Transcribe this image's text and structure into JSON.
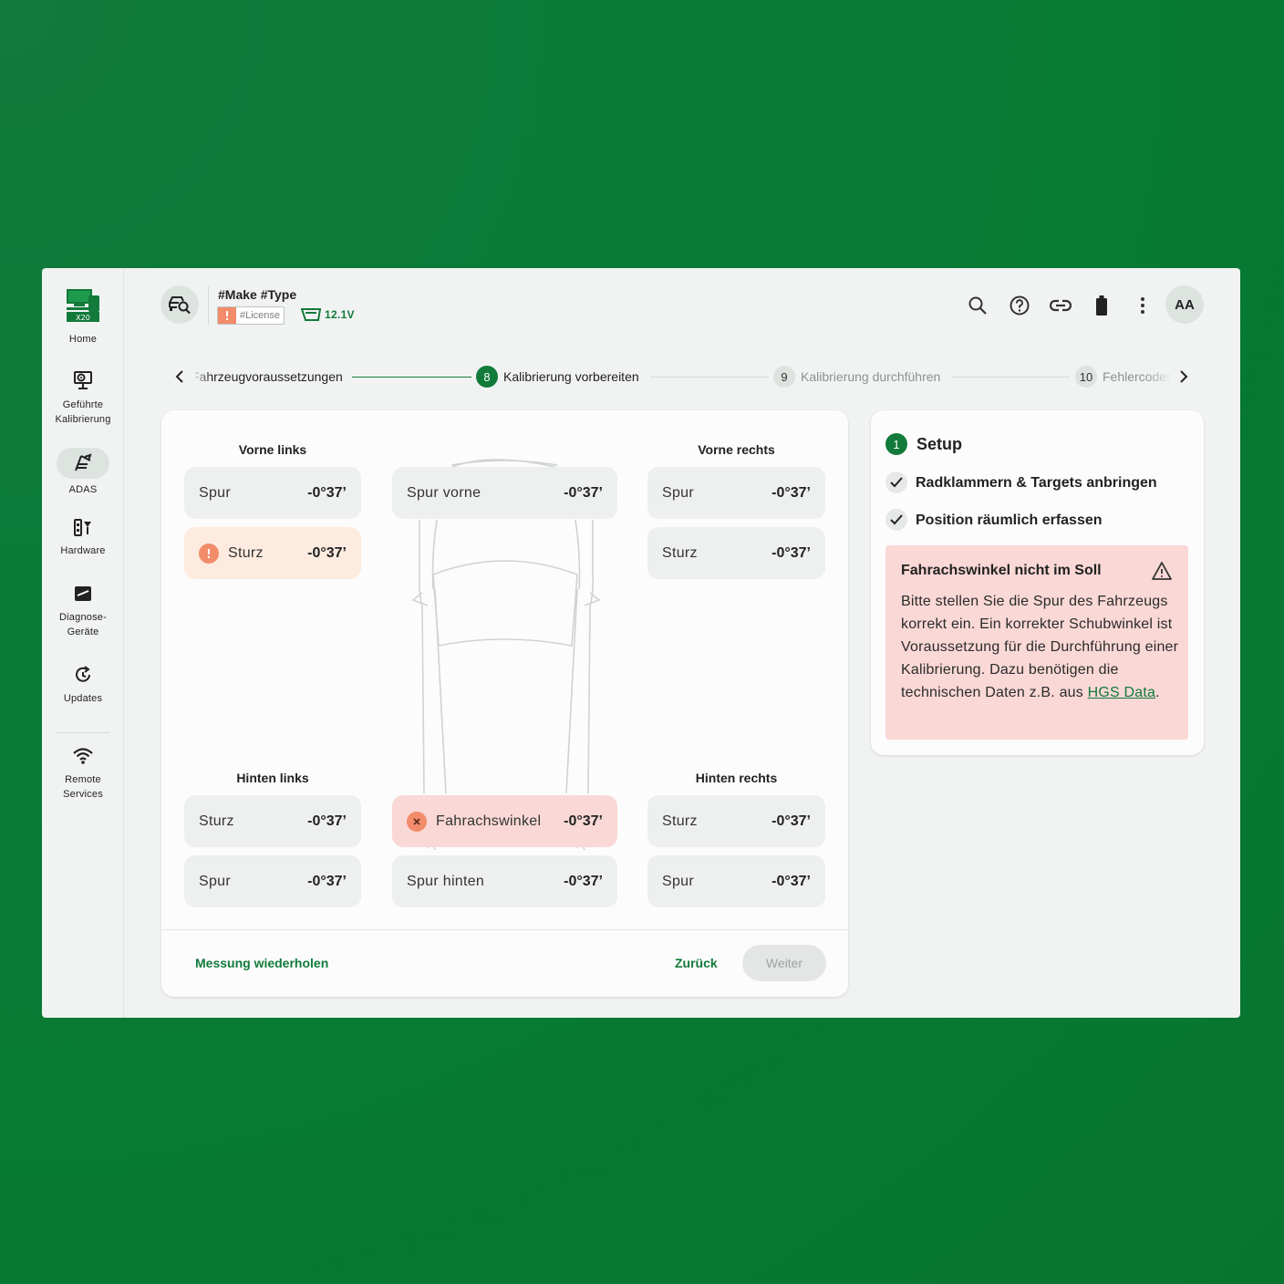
{
  "sidebar": {
    "items": [
      {
        "label": "Home",
        "icon": "x20-logo-icon"
      },
      {
        "label": "Geführte\nKalibrierung",
        "icon": "guided-calibration-icon"
      },
      {
        "label": "ADAS",
        "icon": "adas-icon"
      },
      {
        "label": "Hardware",
        "icon": "hardware-icon"
      },
      {
        "label": "Diagnose-\nGeräte",
        "icon": "diagnosis-device-icon"
      },
      {
        "label": "Updates",
        "icon": "updates-icon"
      },
      {
        "label": "Remote\nServices",
        "icon": "wifi-icon"
      }
    ],
    "logo_text": "X20"
  },
  "header": {
    "vehicle": "#Make #Type",
    "license": "#License",
    "voltage": "12.1V",
    "avatar": "AA",
    "icons": [
      "search-icon",
      "help-icon",
      "link-icon",
      "battery-icon",
      "more-icon"
    ]
  },
  "stepper": {
    "prev": {
      "label": "Fahrzeugvoraussetzungen"
    },
    "current": {
      "num": "8",
      "label": "Kalibrierung vorbereiten"
    },
    "next": {
      "num": "9",
      "label": "Kalibrierung durchführen"
    },
    "after": {
      "num": "10",
      "label": "Fehlercodes"
    }
  },
  "measurements": {
    "front_left": {
      "title": "Vorne links",
      "spur": {
        "label": "Spur",
        "value": "-0°37’"
      },
      "sturz": {
        "label": "Sturz",
        "value": "-0°37’",
        "status": "warning"
      }
    },
    "front_right": {
      "title": "Vorne rechts",
      "spur": {
        "label": "Spur",
        "value": "-0°37’"
      },
      "sturz": {
        "label": "Sturz",
        "value": "-0°37’"
      }
    },
    "rear_left": {
      "title": "Hinten links",
      "sturz": {
        "label": "Sturz",
        "value": "-0°37’"
      },
      "spur": {
        "label": "Spur",
        "value": "-0°37’"
      }
    },
    "rear_right": {
      "title": "Hinten rechts",
      "sturz": {
        "label": "Sturz",
        "value": "-0°37’"
      },
      "spur": {
        "label": "Spur",
        "value": "-0°37’"
      }
    },
    "center": {
      "spur_vorne": {
        "label": "Spur vorne",
        "value": "-0°37’"
      },
      "fahrachswinkel": {
        "label": "Fahrachswinkel",
        "value": "-0°37’",
        "status": "error"
      },
      "spur_hinten": {
        "label": "Spur hinten",
        "value": "-0°37’"
      }
    }
  },
  "footer": {
    "repeat": "Messung wiederholen",
    "back": "Zurück",
    "next": "Weiter"
  },
  "setup": {
    "num": "1",
    "title": "Setup",
    "items": [
      "Radklammern & Targets anbringen",
      "Position räumlich erfassen"
    ]
  },
  "alert": {
    "title": "Fahrachswinkel nicht im Soll",
    "body": "Bitte stellen Sie die Spur des Fahrzeugs korrekt ein. Ein korrekter Schubwinkel ist Voraussetzung für die Durchführung einer Kalibrierung. Dazu benötigen die technischen Daten z.B. aus",
    "link": "HGS Data",
    "trailing": "."
  },
  "colors": {
    "brand": "#127a3a",
    "warning": "#f28c6a",
    "error_bg": "#f9d8d6",
    "warning_bg": "#fdebdf"
  }
}
